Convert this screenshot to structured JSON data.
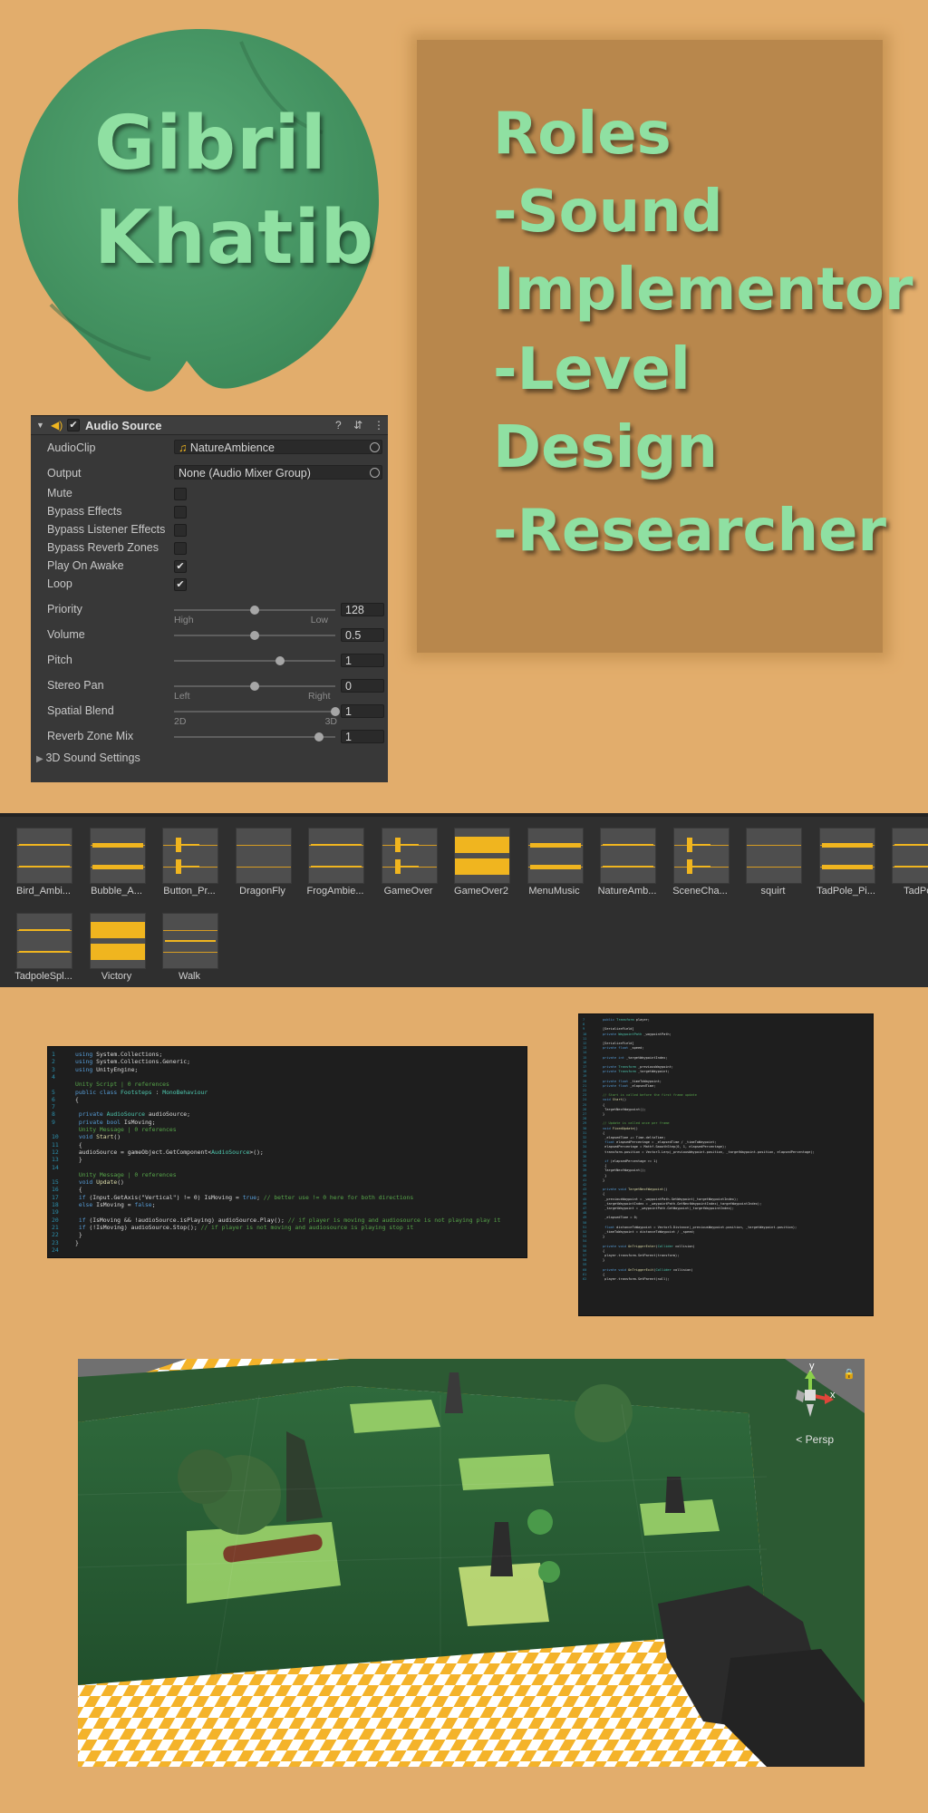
{
  "name": {
    "line1": "Gibril",
    "line2": "Khatib"
  },
  "roles": {
    "lines": [
      "Roles",
      "-Sound",
      "Implementor",
      "-Level",
      "Design",
      "-Researcher"
    ]
  },
  "colors": {
    "background": "#e2ad6c",
    "accent_text": "#8fe0a2",
    "leaf": "#4a9a68",
    "roles_card": "#b8874c",
    "waveform": "#f0b51f"
  },
  "inspector": {
    "title": "Audio Source",
    "icons": [
      "fold-arrow-icon",
      "speaker-icon",
      "help-icon",
      "settings-icon",
      "more-icon"
    ],
    "audio_clip": {
      "label": "AudioClip",
      "value": "NatureAmbience"
    },
    "output": {
      "label": "Output",
      "value": "None (Audio Mixer Group)"
    },
    "toggles": [
      {
        "label": "Mute",
        "checked": false
      },
      {
        "label": "Bypass Effects",
        "checked": false
      },
      {
        "label": "Bypass Listener Effects",
        "checked": false
      },
      {
        "label": "Bypass Reverb Zones",
        "checked": false
      },
      {
        "label": "Play On Awake",
        "checked": true
      },
      {
        "label": "Loop",
        "checked": true
      }
    ],
    "sliders": [
      {
        "label": "Priority",
        "value": "128",
        "fraction": 0.5,
        "min_label": "High",
        "max_label": "Low"
      },
      {
        "label": "Volume",
        "value": "0.5",
        "fraction": 0.5
      },
      {
        "label": "Pitch",
        "value": "1",
        "fraction": 0.66
      },
      {
        "label": "Stereo Pan",
        "value": "0",
        "fraction": 0.5,
        "min_label": "Left",
        "max_label": "Right"
      },
      {
        "label": "Spatial Blend",
        "value": "1",
        "fraction": 1.0,
        "min_label": "2D",
        "max_label": "3D"
      },
      {
        "label": "Reverb Zone Mix",
        "value": "1",
        "fraction": 0.9
      }
    ],
    "foldout": "3D Sound Settings"
  },
  "audio_clips": [
    {
      "label": "Bird_Ambi...",
      "pattern": "thin"
    },
    {
      "label": "Bubble_A...",
      "pattern": "dense"
    },
    {
      "label": "Button_Pr...",
      "pattern": "spike"
    },
    {
      "label": "DragonFly",
      "pattern": "flat"
    },
    {
      "label": "FrogAmbie...",
      "pattern": "thin"
    },
    {
      "label": "GameOver",
      "pattern": "spike"
    },
    {
      "label": "GameOver2",
      "pattern": "full"
    },
    {
      "label": "MenuMusic",
      "pattern": "dense"
    },
    {
      "label": "NatureAmb...",
      "pattern": "thin"
    },
    {
      "label": "SceneCha...",
      "pattern": "spike"
    },
    {
      "label": "squirt",
      "pattern": "flat"
    },
    {
      "label": "TadPole_Pi...",
      "pattern": "dense"
    },
    {
      "label": "TadPol",
      "pattern": "thin"
    },
    {
      "label": "TadpoleSpl...",
      "pattern": "thin"
    },
    {
      "label": "Victory",
      "pattern": "full"
    },
    {
      "label": "Walk",
      "pattern": "single"
    }
  ],
  "code_footsteps": {
    "lines": [
      {
        "n": "1",
        "parts": [
          [
            "kw",
            "using "
          ],
          [
            "tx",
            "System.Collections;"
          ]
        ]
      },
      {
        "n": "2",
        "parts": [
          [
            "kw",
            "using "
          ],
          [
            "tx",
            "System.Collections.Generic;"
          ]
        ]
      },
      {
        "n": "3",
        "parts": [
          [
            "kw",
            "using "
          ],
          [
            "tx",
            "UnityEngine;"
          ]
        ]
      },
      {
        "n": "4",
        "parts": []
      },
      {
        "n": "",
        "parts": [
          [
            "cm",
            "Unity Script | 0 references"
          ]
        ]
      },
      {
        "n": "5",
        "parts": [
          [
            "kw",
            "public class "
          ],
          [
            "ty",
            "Footsteps "
          ],
          [
            "tx",
            ": "
          ],
          [
            "ty",
            "MonoBehaviour"
          ]
        ]
      },
      {
        "n": "6",
        "parts": [
          [
            "tx",
            "{"
          ]
        ]
      },
      {
        "n": "7",
        "parts": []
      },
      {
        "n": "8",
        "parts": [
          [
            "kw",
            "    private "
          ],
          [
            "ty",
            "AudioSource "
          ],
          [
            "tx",
            "audioSource;"
          ]
        ]
      },
      {
        "n": "9",
        "parts": [
          [
            "kw",
            "    private bool "
          ],
          [
            "tx",
            "IsMoving;"
          ]
        ]
      },
      {
        "n": "",
        "parts": [
          [
            "cm",
            "    Unity Message | 0 references"
          ]
        ]
      },
      {
        "n": "10",
        "parts": [
          [
            "kw",
            "    void "
          ],
          [
            "fn",
            "Start"
          ],
          [
            "tx",
            "()"
          ]
        ]
      },
      {
        "n": "11",
        "parts": [
          [
            "tx",
            "    {"
          ]
        ]
      },
      {
        "n": "12",
        "parts": [
          [
            "tx",
            "        audioSource = gameObject.GetComponent<"
          ],
          [
            "ty",
            "AudioSource"
          ],
          [
            "tx",
            ">();"
          ]
        ]
      },
      {
        "n": "13",
        "parts": [
          [
            "tx",
            "    }"
          ]
        ]
      },
      {
        "n": "14",
        "parts": []
      },
      {
        "n": "",
        "parts": [
          [
            "cm",
            "    Unity Message | 0 references"
          ]
        ]
      },
      {
        "n": "15",
        "parts": [
          [
            "kw",
            "    void "
          ],
          [
            "fn",
            "Update"
          ],
          [
            "tx",
            "()"
          ]
        ]
      },
      {
        "n": "16",
        "parts": [
          [
            "tx",
            "    {"
          ]
        ]
      },
      {
        "n": "17",
        "parts": [
          [
            "kw",
            "        if "
          ],
          [
            "tx",
            "(Input.GetAxis(\"Vertical\") != 0) IsMoving = "
          ],
          [
            "kw",
            "true"
          ],
          [
            "tx",
            "; "
          ],
          [
            "cm",
            "// better use != 0 here for both directions"
          ]
        ]
      },
      {
        "n": "18",
        "parts": [
          [
            "kw",
            "        else "
          ],
          [
            "tx",
            "IsMoving = "
          ],
          [
            "kw",
            "false"
          ],
          [
            "tx",
            ";"
          ]
        ]
      },
      {
        "n": "19",
        "parts": []
      },
      {
        "n": "20",
        "parts": [
          [
            "kw",
            "        if "
          ],
          [
            "tx",
            "(IsMoving && !audioSource.isPlaying) audioSource.Play(); "
          ],
          [
            "cm",
            "// if player is moving and audiosource is not playing play it"
          ]
        ]
      },
      {
        "n": "21",
        "parts": [
          [
            "kw",
            "        if "
          ],
          [
            "tx",
            "(!IsMoving) audioSource.Stop(); "
          ],
          [
            "cm",
            "// if player is not moving and audiosource is playing stop it"
          ]
        ]
      },
      {
        "n": "22",
        "parts": [
          [
            "tx",
            "    }"
          ]
        ]
      },
      {
        "n": "23",
        "parts": [
          [
            "tx",
            "}"
          ]
        ]
      },
      {
        "n": "24",
        "parts": []
      }
    ]
  },
  "code_waypoints": {
    "lines": [
      {
        "n": "7",
        "parts": [
          [
            "kw",
            "public "
          ],
          [
            "ty",
            "Transform "
          ],
          [
            "tx",
            "player;"
          ]
        ]
      },
      {
        "n": "8",
        "parts": []
      },
      {
        "n": "9",
        "parts": [
          [
            "tx",
            "[SerializeField]"
          ]
        ]
      },
      {
        "n": "10",
        "parts": [
          [
            "kw",
            "private "
          ],
          [
            "ty",
            "WaypointPath "
          ],
          [
            "tx",
            "_waypointPath;"
          ]
        ]
      },
      {
        "n": "11",
        "parts": []
      },
      {
        "n": "12",
        "parts": [
          [
            "tx",
            "[SerializeField]"
          ]
        ]
      },
      {
        "n": "13",
        "parts": [
          [
            "kw",
            "private float "
          ],
          [
            "tx",
            "_speed;"
          ]
        ]
      },
      {
        "n": "14",
        "parts": []
      },
      {
        "n": "15",
        "parts": [
          [
            "kw",
            "private int "
          ],
          [
            "tx",
            "_targetWaypointIndex;"
          ]
        ]
      },
      {
        "n": "16",
        "parts": []
      },
      {
        "n": "17",
        "parts": [
          [
            "kw",
            "private "
          ],
          [
            "ty",
            "Transform "
          ],
          [
            "tx",
            "_previousWaypoint;"
          ]
        ]
      },
      {
        "n": "18",
        "parts": [
          [
            "kw",
            "private "
          ],
          [
            "ty",
            "Transform "
          ],
          [
            "tx",
            "_targetWaypoint;"
          ]
        ]
      },
      {
        "n": "19",
        "parts": []
      },
      {
        "n": "20",
        "parts": [
          [
            "kw",
            "private float "
          ],
          [
            "tx",
            "_timeToWaypoint;"
          ]
        ]
      },
      {
        "n": "21",
        "parts": [
          [
            "kw",
            "private float "
          ],
          [
            "tx",
            "_elapsedTime;"
          ]
        ]
      },
      {
        "n": "22",
        "parts": []
      },
      {
        "n": "23",
        "parts": [
          [
            "cm",
            "// Start is called before the first frame update"
          ]
        ]
      },
      {
        "n": "24",
        "parts": [
          [
            "kw",
            "void "
          ],
          [
            "fn",
            "Start"
          ],
          [
            "tx",
            "()"
          ]
        ]
      },
      {
        "n": "25",
        "parts": [
          [
            "tx",
            "{"
          ]
        ]
      },
      {
        "n": "26",
        "parts": [
          [
            "tx",
            "    TargetNextWaypoint();"
          ]
        ]
      },
      {
        "n": "27",
        "parts": [
          [
            "tx",
            "}"
          ]
        ]
      },
      {
        "n": "28",
        "parts": []
      },
      {
        "n": "29",
        "parts": [
          [
            "cm",
            "// Update is called once per frame"
          ]
        ]
      },
      {
        "n": "30",
        "parts": [
          [
            "kw",
            "void "
          ],
          [
            "fn",
            "FixedUpdate"
          ],
          [
            "tx",
            "()"
          ]
        ]
      },
      {
        "n": "31",
        "parts": [
          [
            "tx",
            "{"
          ]
        ]
      },
      {
        "n": "32",
        "parts": [
          [
            "tx",
            "    _elapsedTime += Time.deltaTime;"
          ]
        ]
      },
      {
        "n": "33",
        "parts": [
          [
            "kw",
            "    float "
          ],
          [
            "tx",
            "elapsedPercentage = _elapsedTime / _timeToWaypoint;"
          ]
        ]
      },
      {
        "n": "34",
        "parts": [
          [
            "tx",
            "    elapsedPercentage = Mathf.SmoothStep(0, 1, elapsedPercentage);"
          ]
        ]
      },
      {
        "n": "35",
        "parts": [
          [
            "tx",
            "    transform.position = Vector3.Lerp(_previousWaypoint.position, _targetWaypoint.position, elapsedPercentage);"
          ]
        ]
      },
      {
        "n": "36",
        "parts": []
      },
      {
        "n": "37",
        "parts": [
          [
            "kw",
            "    if "
          ],
          [
            "tx",
            "(elapsedPercentage >= 1)"
          ]
        ]
      },
      {
        "n": "38",
        "parts": [
          [
            "tx",
            "    {"
          ]
        ]
      },
      {
        "n": "39",
        "parts": [
          [
            "tx",
            "        TargetNextWaypoint();"
          ]
        ]
      },
      {
        "n": "40",
        "parts": [
          [
            "tx",
            "    }"
          ]
        ]
      },
      {
        "n": "41",
        "parts": [
          [
            "tx",
            "}"
          ]
        ]
      },
      {
        "n": "42",
        "parts": []
      },
      {
        "n": "43",
        "parts": [
          [
            "kw",
            "private void "
          ],
          [
            "fn",
            "TargetNextWaypoint"
          ],
          [
            "tx",
            "()"
          ]
        ]
      },
      {
        "n": "44",
        "parts": [
          [
            "tx",
            "{"
          ]
        ]
      },
      {
        "n": "45",
        "parts": [
          [
            "tx",
            "    _previousWaypoint = _waypointPath.GetWaypoint(_targetWaypointIndex);"
          ]
        ]
      },
      {
        "n": "46",
        "parts": [
          [
            "tx",
            "    _targetWaypointIndex = _waypointPath.GetNextWaypointIndex(_targetWaypointIndex);"
          ]
        ]
      },
      {
        "n": "47",
        "parts": [
          [
            "tx",
            "    _targetWaypoint = _waypointPath.GetWaypoint(_targetWaypointIndex);"
          ]
        ]
      },
      {
        "n": "48",
        "parts": []
      },
      {
        "n": "49",
        "parts": [
          [
            "tx",
            "    _elapsedTime = 0;"
          ]
        ]
      },
      {
        "n": "50",
        "parts": []
      },
      {
        "n": "51",
        "parts": [
          [
            "kw",
            "    float "
          ],
          [
            "tx",
            "distanceToWaypoint = Vector3.Distance(_previousWaypoint.position, _targetWaypoint.position);"
          ]
        ]
      },
      {
        "n": "52",
        "parts": [
          [
            "tx",
            "    _timeToWaypoint = distanceToWaypoint / _speed;"
          ]
        ]
      },
      {
        "n": "53",
        "parts": [
          [
            "tx",
            "}"
          ]
        ]
      },
      {
        "n": "54",
        "parts": []
      },
      {
        "n": "55",
        "parts": [
          [
            "kw",
            "private void "
          ],
          [
            "fn",
            "OnTriggerEnter"
          ],
          [
            "tx",
            "("
          ],
          [
            "ty",
            "Collider "
          ],
          [
            "tx",
            "collision)"
          ]
        ]
      },
      {
        "n": "56",
        "parts": [
          [
            "tx",
            "{"
          ]
        ]
      },
      {
        "n": "57",
        "parts": [
          [
            "tx",
            "    player.transform.SetParent(transform);"
          ]
        ]
      },
      {
        "n": "58",
        "parts": [
          [
            "tx",
            "}"
          ]
        ]
      },
      {
        "n": "59",
        "parts": []
      },
      {
        "n": "60",
        "parts": [
          [
            "kw",
            "private void "
          ],
          [
            "fn",
            "OnTriggerExit"
          ],
          [
            "tx",
            "("
          ],
          [
            "ty",
            "Collider "
          ],
          [
            "tx",
            "collision)"
          ]
        ]
      },
      {
        "n": "61",
        "parts": [
          [
            "tx",
            "{"
          ]
        ]
      },
      {
        "n": "62",
        "parts": [
          [
            "tx",
            "    player.transform.SetParent(null);"
          ]
        ]
      }
    ]
  },
  "scene": {
    "gizmo_labels": {
      "x": "x",
      "y": "y"
    },
    "persp_label": "< Persp",
    "icons": [
      "scene-gizmo-icon",
      "lock-icon"
    ]
  }
}
